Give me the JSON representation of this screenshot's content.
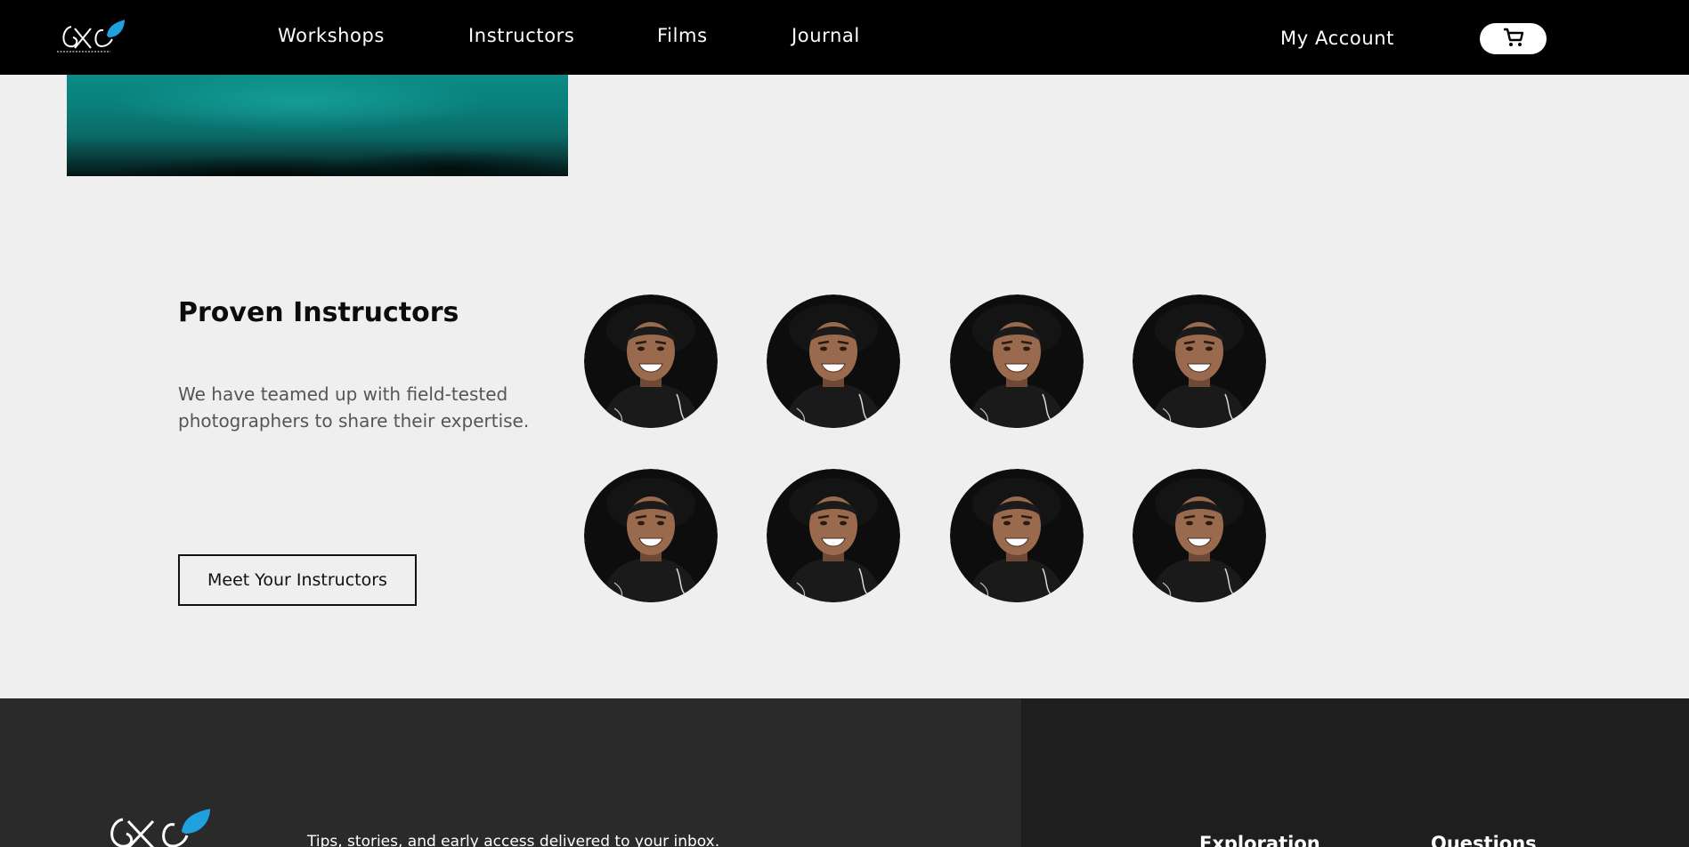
{
  "header": {
    "logo_alt": "EXE logo",
    "nav": [
      "Workshops",
      "Instructors",
      "Films",
      "Journal"
    ],
    "account_label": "My Account",
    "cart_icon": "cart-icon"
  },
  "instructors_section": {
    "title": "Proven Instructors",
    "description": "We have teamed up with field-tested photographers to share their expertise.",
    "cta_label": "Meet Your Instructors",
    "avatar_count": 8
  },
  "footer": {
    "newsletter_text": "Tips, stories, and early access delivered to your inbox.",
    "columns": [
      "Exploration",
      "Questions"
    ]
  },
  "colors": {
    "header_bg": "#000000",
    "page_bg": "#efefef",
    "accent_leaf": "#1fa1e0",
    "footer_left_bg": "#2a2a2a",
    "footer_right_bg": "#1f1e1f"
  }
}
